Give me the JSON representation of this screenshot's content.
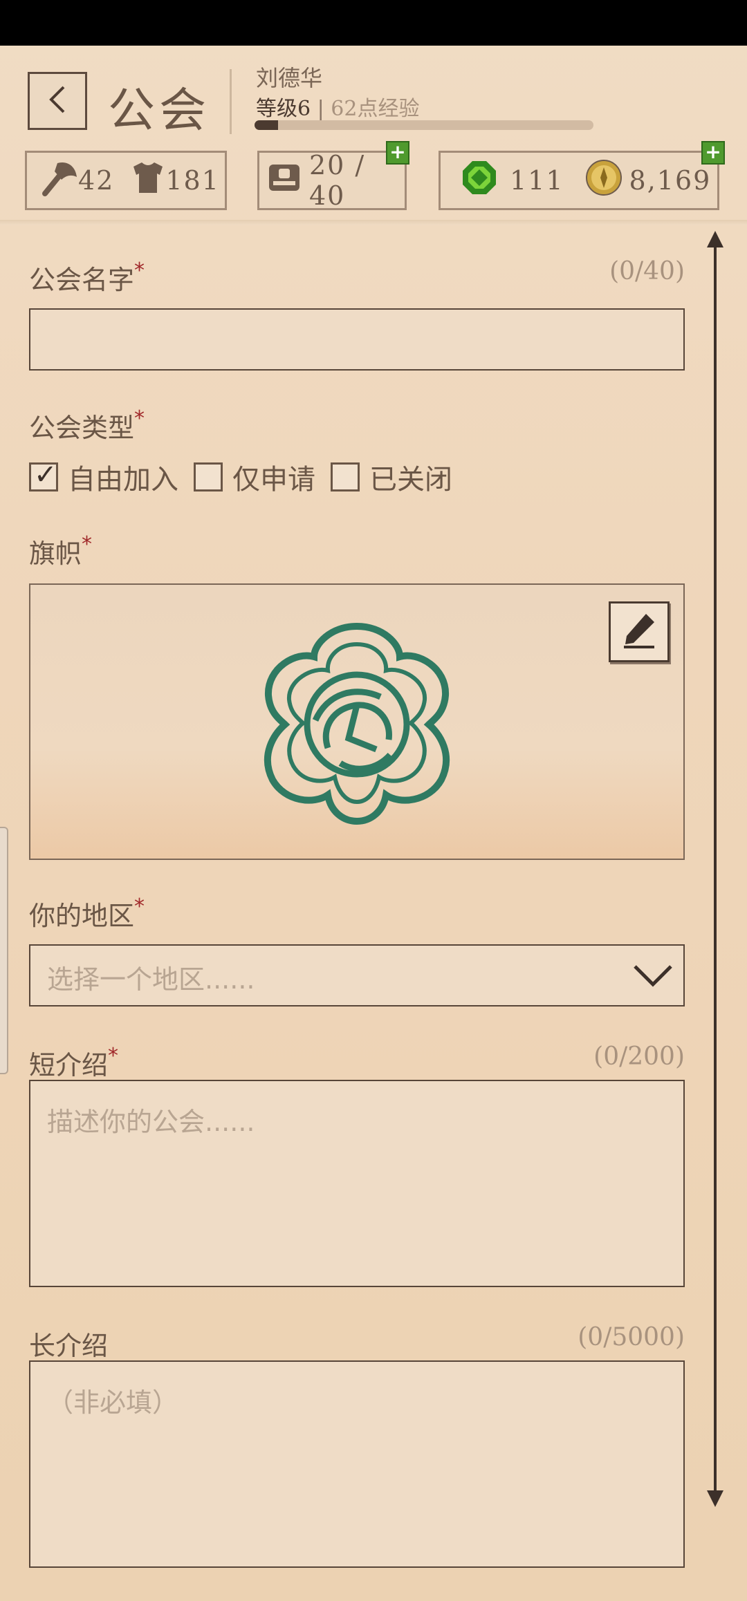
{
  "header": {
    "title": "公会",
    "player_name": "刘德华",
    "level_text": "等级6",
    "xp_text": "62点经验",
    "xp_progress": 0.07
  },
  "stats": {
    "attack": "42",
    "defense": "181",
    "members": "20 / 40",
    "gems": "111",
    "gold": "8,169"
  },
  "form": {
    "guild_name": {
      "label": "公会名字",
      "counter": "(0/40)",
      "value": ""
    },
    "guild_type": {
      "label": "公会类型",
      "options": [
        {
          "label": "自由加入",
          "checked": true
        },
        {
          "label": "仅申请",
          "checked": false
        },
        {
          "label": "已关闭",
          "checked": false
        }
      ]
    },
    "banner": {
      "label": "旗帜"
    },
    "region": {
      "label": "你的地区",
      "placeholder": "选择一个地区......"
    },
    "short_intro": {
      "label": "短介绍",
      "counter": "(0/200)",
      "placeholder": "描述你的公会......"
    },
    "long_intro": {
      "label": "长介绍",
      "counter": "(0/5000)",
      "placeholder": "（非必填）"
    },
    "required_mark": "*"
  },
  "colors": {
    "emblem": "#2f7a62",
    "plus_badge": "#4f9a2e",
    "required": "#a0282a"
  }
}
